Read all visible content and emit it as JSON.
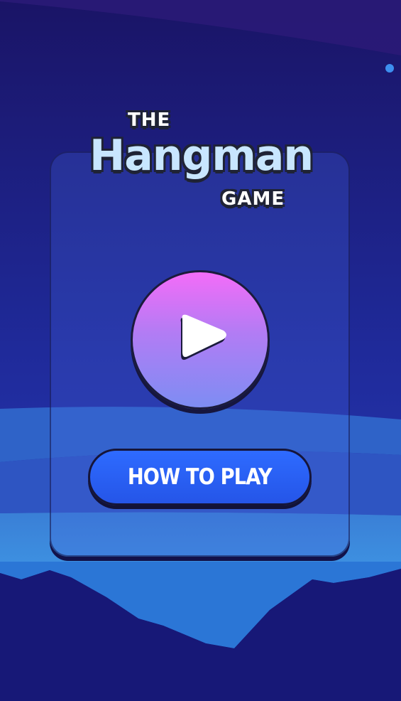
{
  "logo": {
    "top_word": "THE",
    "main_word": "Hangman",
    "bottom_word": "GAME"
  },
  "buttons": {
    "play_icon": "play-icon",
    "how_to_play_label": "HOW TO PLAY"
  },
  "colors": {
    "background_dark": "#1a1a7a",
    "play_gradient_top": "#f36cf8",
    "play_gradient_bottom": "#7d8df3",
    "how_to_play_button": "#2e6bff",
    "logo_text": "#c8e6ff",
    "outline": "#1f2335"
  }
}
